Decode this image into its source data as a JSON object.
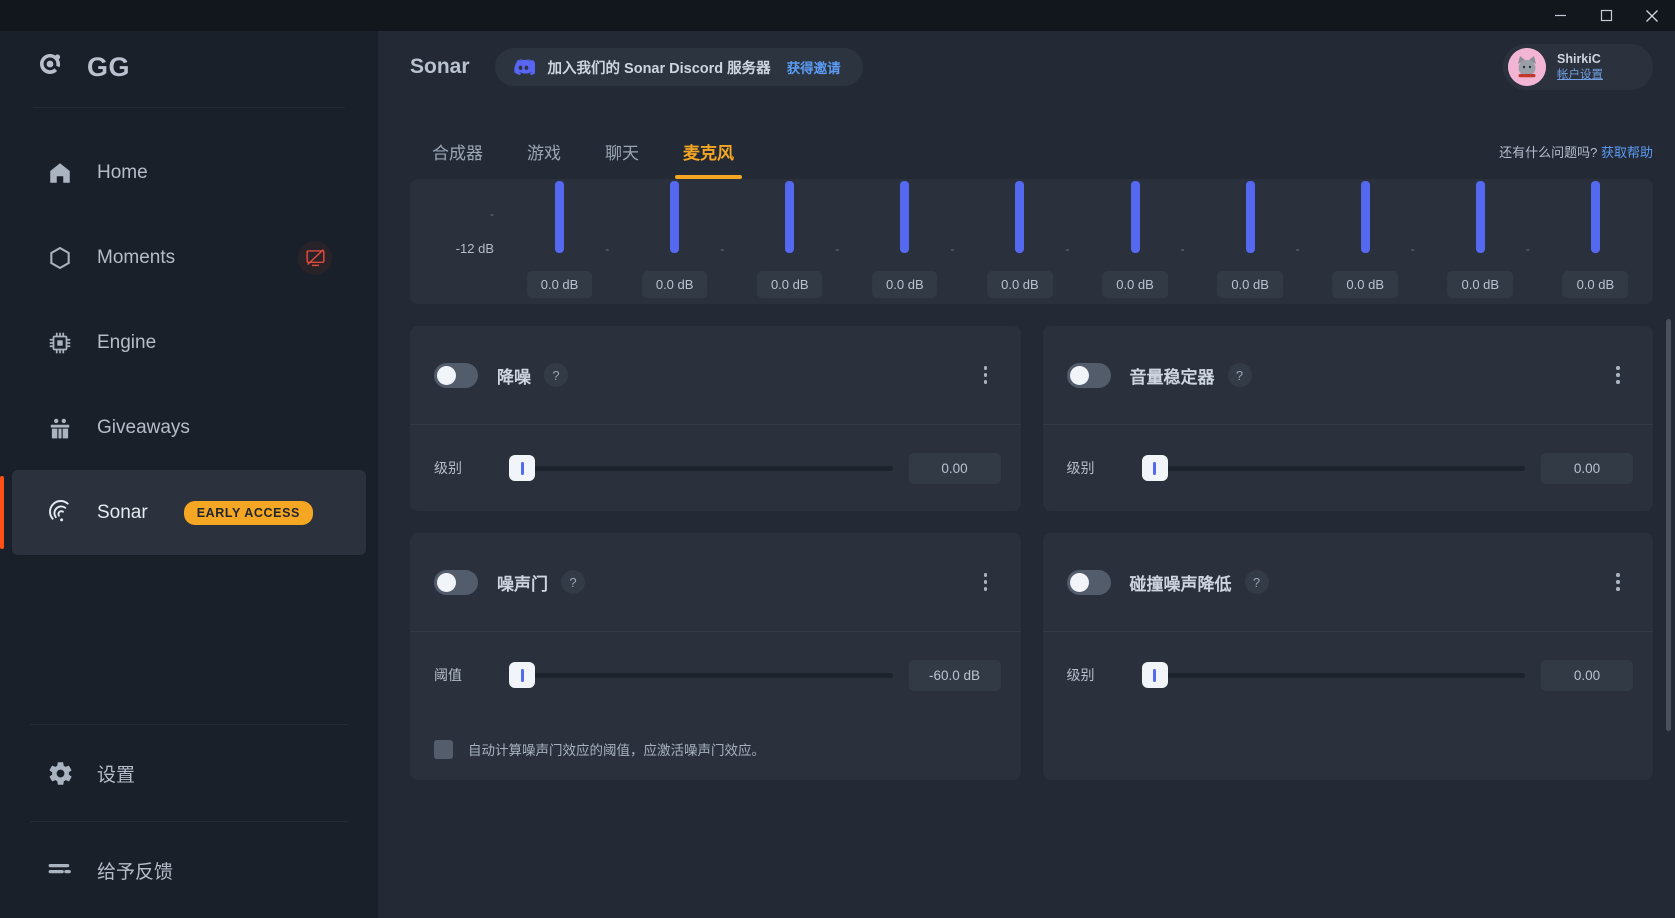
{
  "window": {
    "minimize_icon": "minimize-icon",
    "maximize_icon": "maximize-icon",
    "close_icon": "close-icon"
  },
  "sidebar": {
    "brand": "GG",
    "brand_logo_icon": "steelseries-logo-icon",
    "items": [
      {
        "label": "Home",
        "icon": "home-icon",
        "active": false
      },
      {
        "label": "Moments",
        "icon": "hexagon-icon",
        "active": false,
        "badge_icon": "screen-record-off-icon"
      },
      {
        "label": "Engine",
        "icon": "chip-icon",
        "active": false
      },
      {
        "label": "Giveaways",
        "icon": "gift-icon",
        "active": false
      },
      {
        "label": "Sonar",
        "icon": "sonar-waves-icon",
        "active": true,
        "badge": "EARLY ACCESS"
      }
    ],
    "bottom_items": [
      {
        "label": "设置",
        "icon": "gear-icon"
      },
      {
        "label": "给予反馈",
        "icon": "feedback-bars-icon"
      }
    ]
  },
  "header": {
    "title": "Sonar",
    "discord": {
      "icon": "discord-icon",
      "text": "加入我们的 Sonar Discord 服务器",
      "link": "获得邀请"
    },
    "profile": {
      "avatar_icon": "cat-avatar",
      "name": "ShirkiC",
      "sub": "帐户设置"
    }
  },
  "tabs": {
    "items": [
      {
        "label": "合成器",
        "active": false
      },
      {
        "label": "游戏",
        "active": false
      },
      {
        "label": "聊天",
        "active": false
      },
      {
        "label": "麦克风",
        "active": true
      }
    ],
    "help_text": "还有什么问题吗?",
    "help_link": "获取帮助"
  },
  "equalizer": {
    "axis_label": "-12 dB",
    "bands": [
      {
        "value": "0.0 dB"
      },
      {
        "value": "0.0 dB"
      },
      {
        "value": "0.0 dB"
      },
      {
        "value": "0.0 dB"
      },
      {
        "value": "0.0 dB"
      },
      {
        "value": "0.0 dB"
      },
      {
        "value": "0.0 dB"
      },
      {
        "value": "0.0 dB"
      },
      {
        "value": "0.0 dB"
      },
      {
        "value": "0.0 dB"
      }
    ]
  },
  "cards": [
    {
      "title": "降噪",
      "help_icon": "question-mark-icon",
      "menu_icon": "kebab-menu-icon",
      "toggle_state": "off",
      "row_label": "级别",
      "row_value": "0.00"
    },
    {
      "title": "音量稳定器",
      "help_icon": "question-mark-icon",
      "menu_icon": "kebab-menu-icon",
      "toggle_state": "off",
      "row_label": "级别",
      "row_value": "0.00"
    },
    {
      "title": "噪声门",
      "help_icon": "question-mark-icon",
      "menu_icon": "kebab-menu-icon",
      "toggle_state": "off",
      "row_label": "阈值",
      "row_value": "-60.0 dB",
      "checkbox_text": "自动计算噪声门效应的阈值，应激活噪声门效应。"
    },
    {
      "title": "碰撞噪声降低",
      "help_icon": "question-mark-icon",
      "menu_icon": "kebab-menu-icon",
      "toggle_state": "off",
      "row_label": "级别",
      "row_value": "0.00"
    }
  ],
  "colors": {
    "accent_orange": "#ff5116",
    "badge_yellow": "#f5a623",
    "link_blue": "#5b9bf3",
    "eq_bar_blue": "#5468f0",
    "discord_blurple": "#5865f2"
  }
}
